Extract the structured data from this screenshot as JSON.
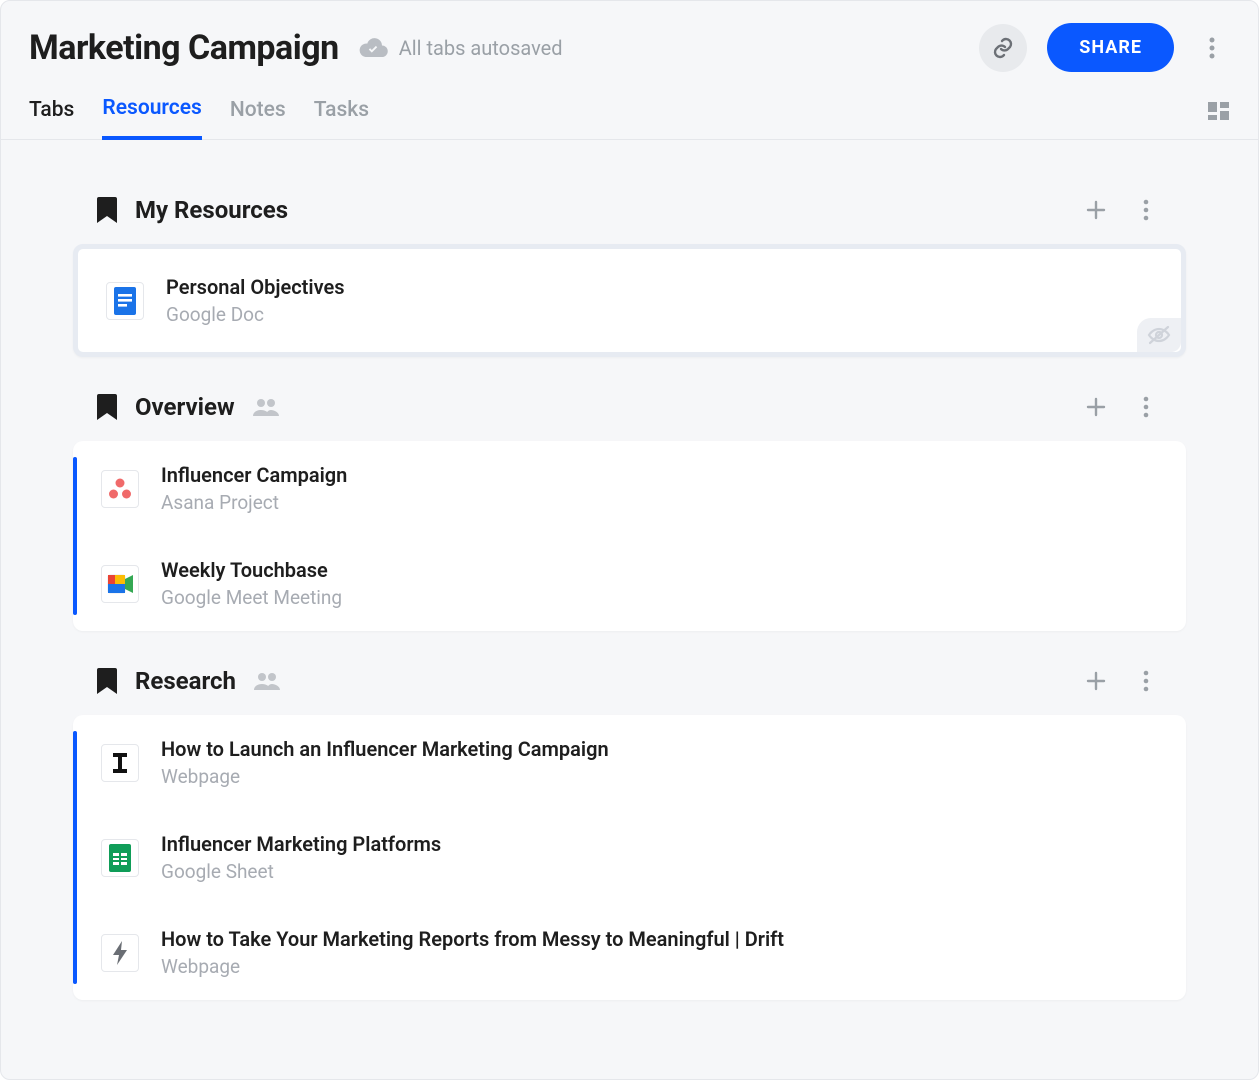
{
  "header": {
    "title": "Marketing Campaign",
    "autosave_label": "All tabs autosaved",
    "share_label": "SHARE"
  },
  "tabs": {
    "items": [
      "Tabs",
      "Resources",
      "Notes",
      "Tasks"
    ],
    "active_index": 1
  },
  "colors": {
    "accent": "#0a58ff"
  },
  "sections": [
    {
      "title": "My Resources",
      "has_people": false,
      "card_style": "highlight",
      "has_hidden_badge": true,
      "items": [
        {
          "title": "Personal Objectives",
          "subtitle": "Google Doc",
          "icon": "google-doc"
        }
      ]
    },
    {
      "title": "Overview",
      "has_people": true,
      "card_style": "stripe",
      "has_hidden_badge": false,
      "items": [
        {
          "title": "Influencer Campaign",
          "subtitle": "Asana Project",
          "icon": "asana"
        },
        {
          "title": "Weekly Touchbase",
          "subtitle": "Google Meet Meeting",
          "icon": "google-meet"
        }
      ]
    },
    {
      "title": "Research",
      "has_people": true,
      "card_style": "stripe-short",
      "has_hidden_badge": false,
      "items": [
        {
          "title": "How to Launch an Influencer Marketing Campaign",
          "subtitle": "Webpage",
          "icon": "letter-i"
        },
        {
          "title": "Influencer Marketing Platforms",
          "subtitle": "Google Sheet",
          "icon": "google-sheet"
        },
        {
          "title": "How to Take Your Marketing Reports from Messy to Meaningful | Drift",
          "subtitle": "Webpage",
          "icon": "bolt"
        }
      ]
    }
  ]
}
